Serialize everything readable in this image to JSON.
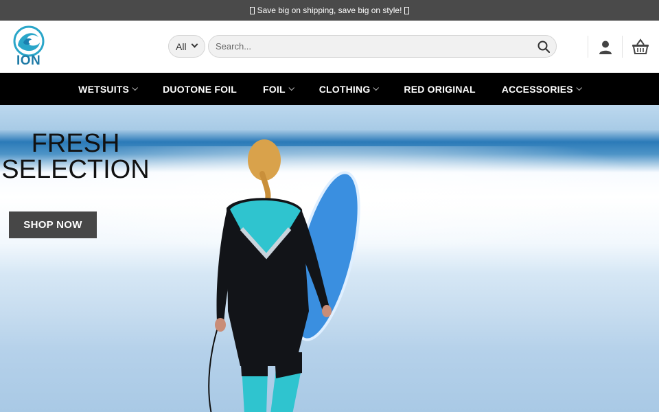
{
  "topbar": {
    "text": "Save big on shipping, save big on style!"
  },
  "brand": {
    "name": "ION",
    "color": "#1e7aa6"
  },
  "search": {
    "category": "All",
    "placeholder": "Search..."
  },
  "nav": {
    "items": [
      {
        "label": "WETSUITS",
        "dropdown": true
      },
      {
        "label": "DUOTONE FOIL",
        "dropdown": false
      },
      {
        "label": "FOIL",
        "dropdown": true
      },
      {
        "label": "CLOTHING",
        "dropdown": true
      },
      {
        "label": "RED ORIGINAL",
        "dropdown": false
      },
      {
        "label": "ACCESSORIES",
        "dropdown": true
      }
    ]
  },
  "hero": {
    "title_line1": "FRESH",
    "title_line2": "SELECTION",
    "cta": "SHOP NOW"
  },
  "icons": [
    "search-icon",
    "user-icon",
    "basket-icon",
    "chevron-down-icon"
  ],
  "colors": {
    "topbar": "#4a4a4a",
    "nav": "#000000",
    "cta": "#474747",
    "wetsuit_accent": "#2fc4cf"
  }
}
